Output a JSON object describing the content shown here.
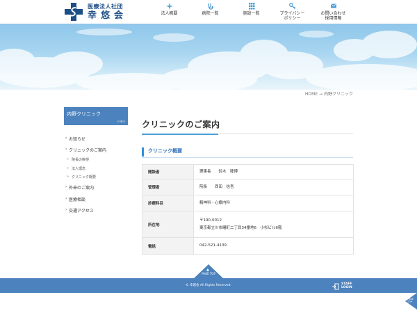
{
  "header": {
    "logo": {
      "subtitle": "医療法人社団",
      "name": "幸悠会"
    },
    "nav": [
      {
        "label": "法人概要",
        "icon": "sparkle-icon"
      },
      {
        "label": "病院一覧",
        "icon": "stethoscope-icon"
      },
      {
        "label": "施設一覧",
        "icon": "grid-icon"
      },
      {
        "label": "プライバシー\nポリシー",
        "icon": "key-icon"
      },
      {
        "label": "お問い合わせ\n採用情報",
        "icon": "mail-icon"
      }
    ]
  },
  "breadcrumb": {
    "home": "HOME",
    "sep": "→",
    "current": "内野クリニック"
  },
  "sidebar": {
    "title": "内野クリニック",
    "title_en": "index",
    "items": [
      {
        "label": "お知らせ",
        "level": 1
      },
      {
        "label": "クリニックのご案内",
        "level": 1
      },
      {
        "label": "院長の挨拶",
        "level": 2
      },
      {
        "label": "法人理念",
        "level": 2
      },
      {
        "label": "クリニック概要",
        "level": 2
      },
      {
        "label": "外来のご案内",
        "level": 1
      },
      {
        "label": "医療相談",
        "level": 1
      },
      {
        "label": "交通アクセス",
        "level": 1
      }
    ]
  },
  "main": {
    "title": "クリニックのご案内",
    "section": "クリニック概要",
    "table": [
      {
        "header": "開設者",
        "lines": [
          "理事長　　鈴木　隆博"
        ]
      },
      {
        "header": "管理者",
        "lines": [
          "院長　　西田　信吾"
        ]
      },
      {
        "header": "診療科目",
        "lines": [
          "精神科・心療内科"
        ]
      },
      {
        "header": "所在地",
        "lines": [
          "〒190-0012",
          "東京都立川市曙町二丁目34番地6　小杉ビル6階"
        ]
      },
      {
        "header": "電話",
        "lines": [
          "042-521-4139"
        ]
      }
    ]
  },
  "footer": {
    "pagetop": "PAGE TOP",
    "copyright": "© 幸悠会 All Rights Reserved.",
    "staff_line1": "STAFF",
    "staff_line2": "LOGIN",
    "corner_pagetop": "PAGE TOP"
  },
  "colors": {
    "brand": "#1d4f86",
    "accent": "#4c82bd",
    "highlight": "#2f8fd8"
  }
}
